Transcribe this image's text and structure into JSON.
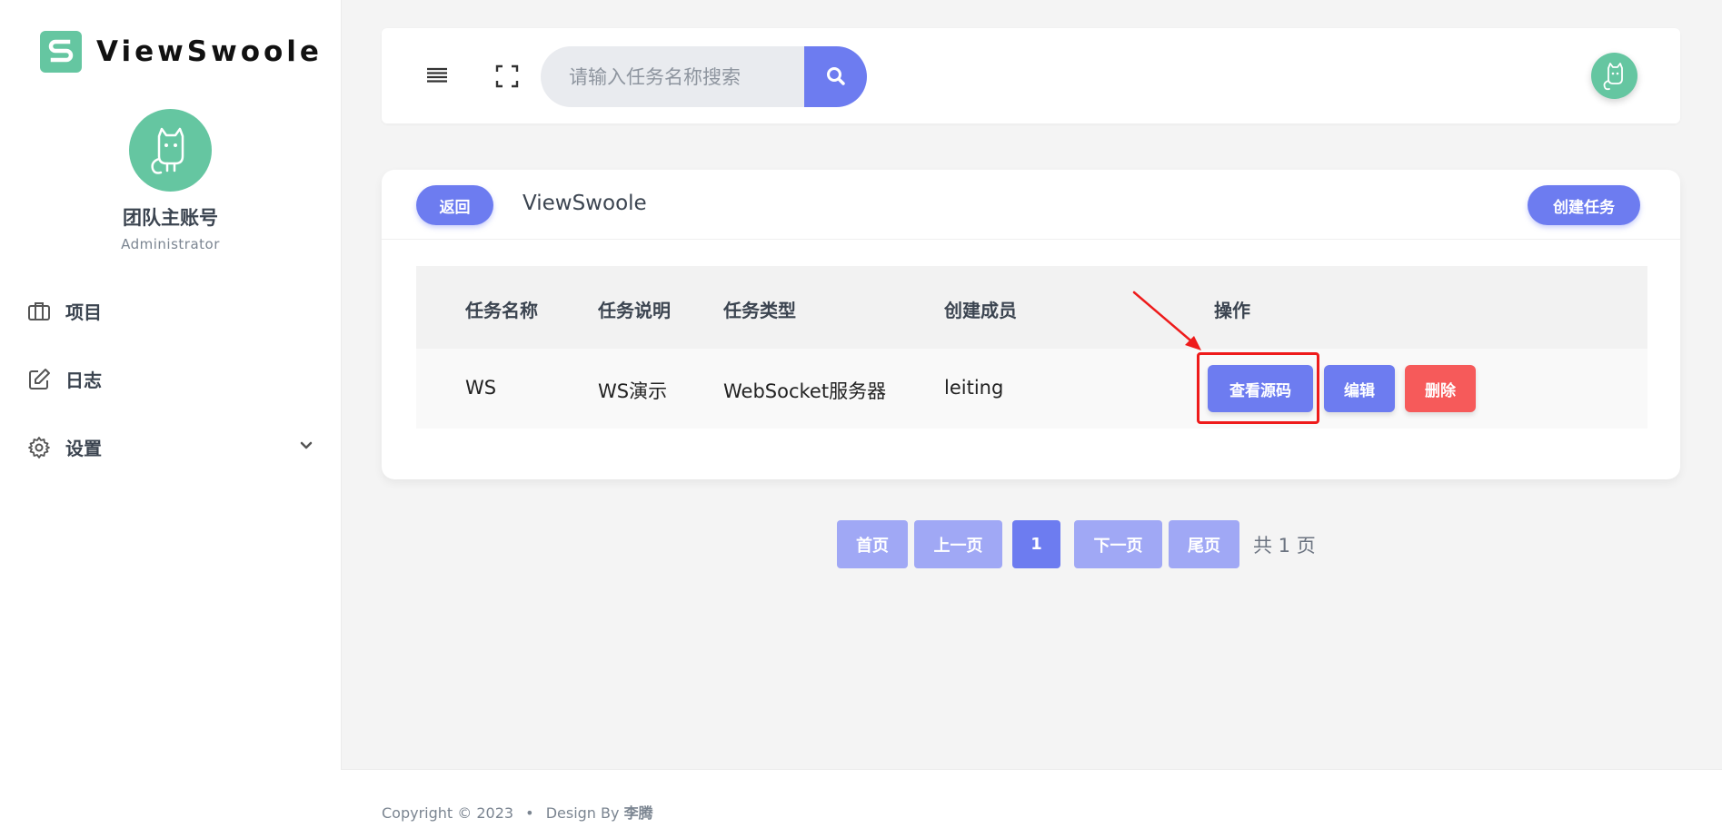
{
  "brand": {
    "name": "ViewSwoole",
    "logo_letter": "S",
    "color": "#65c6a1"
  },
  "profile": {
    "name": "团队主账号",
    "role": "Administrator"
  },
  "nav": {
    "items": [
      {
        "label": "项目",
        "icon": "briefcase-icon"
      },
      {
        "label": "日志",
        "icon": "edit-icon"
      },
      {
        "label": "设置",
        "icon": "gear-icon"
      }
    ]
  },
  "search": {
    "placeholder": "请输入任务名称搜索",
    "value": ""
  },
  "card": {
    "back_label": "返回",
    "title": "ViewSwoole",
    "create_label": "创建任务"
  },
  "table": {
    "headers": [
      "任务名称",
      "任务说明",
      "任务类型",
      "创建成员",
      "操作"
    ],
    "rows": [
      {
        "name": "WS",
        "description": "WS演示",
        "type": "WebSocket服务器",
        "creator": "leiting"
      }
    ],
    "actions": {
      "view": "查看源码",
      "edit": "编辑",
      "delete": "删除"
    }
  },
  "pagination": {
    "first": "首页",
    "prev": "上一页",
    "current": "1",
    "next": "下一页",
    "last": "尾页",
    "total_text": "共 1 页"
  },
  "footer": {
    "copyright": "Copyright © 2023",
    "separator": "•",
    "design_by": "Design By",
    "author": "李腾"
  },
  "colors": {
    "accent": "#6d7cf0",
    "danger": "#f65a5a",
    "brand": "#65c6a1",
    "highlight": "#ee1b1b"
  }
}
